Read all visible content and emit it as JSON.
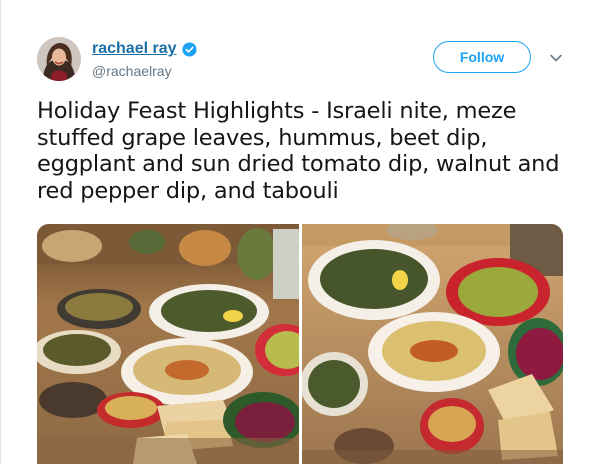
{
  "tweet": {
    "author": {
      "display_name": "rachael ray",
      "handle": "@rachaelray",
      "verified": true,
      "avatar_icon": "avatar-photo"
    },
    "follow_label": "Follow",
    "menu_icon": "chevron-down-icon",
    "text": "Holiday Feast Highlights - Israeli nite, meze stuffed grape leaves, hummus, beet dip, eggplant and sun dried tomato dip, walnut and red pepper dip, and tabouli",
    "media": [
      {
        "kind": "photo",
        "subject": "meze spread"
      },
      {
        "kind": "photo",
        "subject": "meze spread close-up"
      }
    ]
  },
  "colors": {
    "accent": "#1da1f2",
    "name_link": "#1b6fa8",
    "handle": "#657786",
    "text": "#14171a"
  }
}
